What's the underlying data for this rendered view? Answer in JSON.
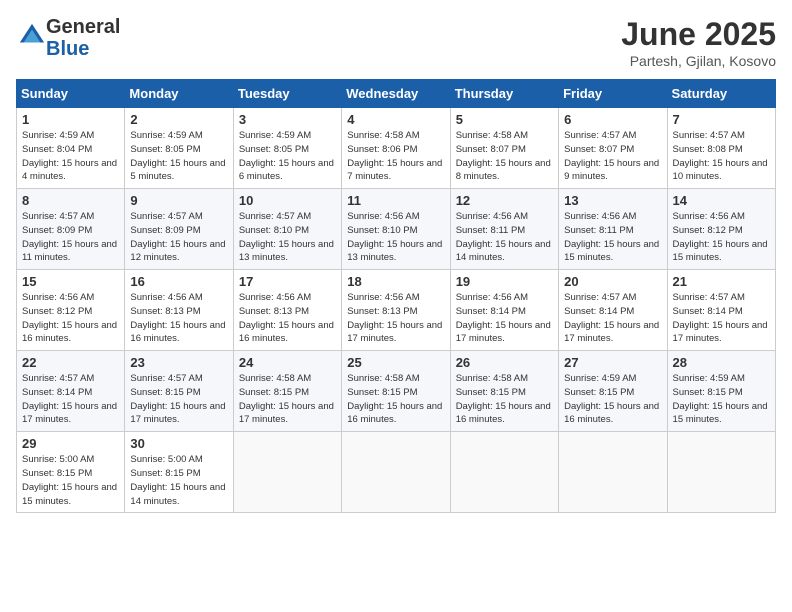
{
  "header": {
    "logo_line1": "General",
    "logo_line2": "Blue",
    "month_title": "June 2025",
    "location": "Partesh, Gjilan, Kosovo"
  },
  "weekdays": [
    "Sunday",
    "Monday",
    "Tuesday",
    "Wednesday",
    "Thursday",
    "Friday",
    "Saturday"
  ],
  "weeks": [
    [
      {
        "day": "1",
        "sunrise": "Sunrise: 4:59 AM",
        "sunset": "Sunset: 8:04 PM",
        "daylight": "Daylight: 15 hours and 4 minutes."
      },
      {
        "day": "2",
        "sunrise": "Sunrise: 4:59 AM",
        "sunset": "Sunset: 8:05 PM",
        "daylight": "Daylight: 15 hours and 5 minutes."
      },
      {
        "day": "3",
        "sunrise": "Sunrise: 4:59 AM",
        "sunset": "Sunset: 8:05 PM",
        "daylight": "Daylight: 15 hours and 6 minutes."
      },
      {
        "day": "4",
        "sunrise": "Sunrise: 4:58 AM",
        "sunset": "Sunset: 8:06 PM",
        "daylight": "Daylight: 15 hours and 7 minutes."
      },
      {
        "day": "5",
        "sunrise": "Sunrise: 4:58 AM",
        "sunset": "Sunset: 8:07 PM",
        "daylight": "Daylight: 15 hours and 8 minutes."
      },
      {
        "day": "6",
        "sunrise": "Sunrise: 4:57 AM",
        "sunset": "Sunset: 8:07 PM",
        "daylight": "Daylight: 15 hours and 9 minutes."
      },
      {
        "day": "7",
        "sunrise": "Sunrise: 4:57 AM",
        "sunset": "Sunset: 8:08 PM",
        "daylight": "Daylight: 15 hours and 10 minutes."
      }
    ],
    [
      {
        "day": "8",
        "sunrise": "Sunrise: 4:57 AM",
        "sunset": "Sunset: 8:09 PM",
        "daylight": "Daylight: 15 hours and 11 minutes."
      },
      {
        "day": "9",
        "sunrise": "Sunrise: 4:57 AM",
        "sunset": "Sunset: 8:09 PM",
        "daylight": "Daylight: 15 hours and 12 minutes."
      },
      {
        "day": "10",
        "sunrise": "Sunrise: 4:57 AM",
        "sunset": "Sunset: 8:10 PM",
        "daylight": "Daylight: 15 hours and 13 minutes."
      },
      {
        "day": "11",
        "sunrise": "Sunrise: 4:56 AM",
        "sunset": "Sunset: 8:10 PM",
        "daylight": "Daylight: 15 hours and 13 minutes."
      },
      {
        "day": "12",
        "sunrise": "Sunrise: 4:56 AM",
        "sunset": "Sunset: 8:11 PM",
        "daylight": "Daylight: 15 hours and 14 minutes."
      },
      {
        "day": "13",
        "sunrise": "Sunrise: 4:56 AM",
        "sunset": "Sunset: 8:11 PM",
        "daylight": "Daylight: 15 hours and 15 minutes."
      },
      {
        "day": "14",
        "sunrise": "Sunrise: 4:56 AM",
        "sunset": "Sunset: 8:12 PM",
        "daylight": "Daylight: 15 hours and 15 minutes."
      }
    ],
    [
      {
        "day": "15",
        "sunrise": "Sunrise: 4:56 AM",
        "sunset": "Sunset: 8:12 PM",
        "daylight": "Daylight: 15 hours and 16 minutes."
      },
      {
        "day": "16",
        "sunrise": "Sunrise: 4:56 AM",
        "sunset": "Sunset: 8:13 PM",
        "daylight": "Daylight: 15 hours and 16 minutes."
      },
      {
        "day": "17",
        "sunrise": "Sunrise: 4:56 AM",
        "sunset": "Sunset: 8:13 PM",
        "daylight": "Daylight: 15 hours and 16 minutes."
      },
      {
        "day": "18",
        "sunrise": "Sunrise: 4:56 AM",
        "sunset": "Sunset: 8:13 PM",
        "daylight": "Daylight: 15 hours and 17 minutes."
      },
      {
        "day": "19",
        "sunrise": "Sunrise: 4:56 AM",
        "sunset": "Sunset: 8:14 PM",
        "daylight": "Daylight: 15 hours and 17 minutes."
      },
      {
        "day": "20",
        "sunrise": "Sunrise: 4:57 AM",
        "sunset": "Sunset: 8:14 PM",
        "daylight": "Daylight: 15 hours and 17 minutes."
      },
      {
        "day": "21",
        "sunrise": "Sunrise: 4:57 AM",
        "sunset": "Sunset: 8:14 PM",
        "daylight": "Daylight: 15 hours and 17 minutes."
      }
    ],
    [
      {
        "day": "22",
        "sunrise": "Sunrise: 4:57 AM",
        "sunset": "Sunset: 8:14 PM",
        "daylight": "Daylight: 15 hours and 17 minutes."
      },
      {
        "day": "23",
        "sunrise": "Sunrise: 4:57 AM",
        "sunset": "Sunset: 8:15 PM",
        "daylight": "Daylight: 15 hours and 17 minutes."
      },
      {
        "day": "24",
        "sunrise": "Sunrise: 4:58 AM",
        "sunset": "Sunset: 8:15 PM",
        "daylight": "Daylight: 15 hours and 17 minutes."
      },
      {
        "day": "25",
        "sunrise": "Sunrise: 4:58 AM",
        "sunset": "Sunset: 8:15 PM",
        "daylight": "Daylight: 15 hours and 16 minutes."
      },
      {
        "day": "26",
        "sunrise": "Sunrise: 4:58 AM",
        "sunset": "Sunset: 8:15 PM",
        "daylight": "Daylight: 15 hours and 16 minutes."
      },
      {
        "day": "27",
        "sunrise": "Sunrise: 4:59 AM",
        "sunset": "Sunset: 8:15 PM",
        "daylight": "Daylight: 15 hours and 16 minutes."
      },
      {
        "day": "28",
        "sunrise": "Sunrise: 4:59 AM",
        "sunset": "Sunset: 8:15 PM",
        "daylight": "Daylight: 15 hours and 15 minutes."
      }
    ],
    [
      {
        "day": "29",
        "sunrise": "Sunrise: 5:00 AM",
        "sunset": "Sunset: 8:15 PM",
        "daylight": "Daylight: 15 hours and 15 minutes."
      },
      {
        "day": "30",
        "sunrise": "Sunrise: 5:00 AM",
        "sunset": "Sunset: 8:15 PM",
        "daylight": "Daylight: 15 hours and 14 minutes."
      },
      null,
      null,
      null,
      null,
      null
    ]
  ]
}
